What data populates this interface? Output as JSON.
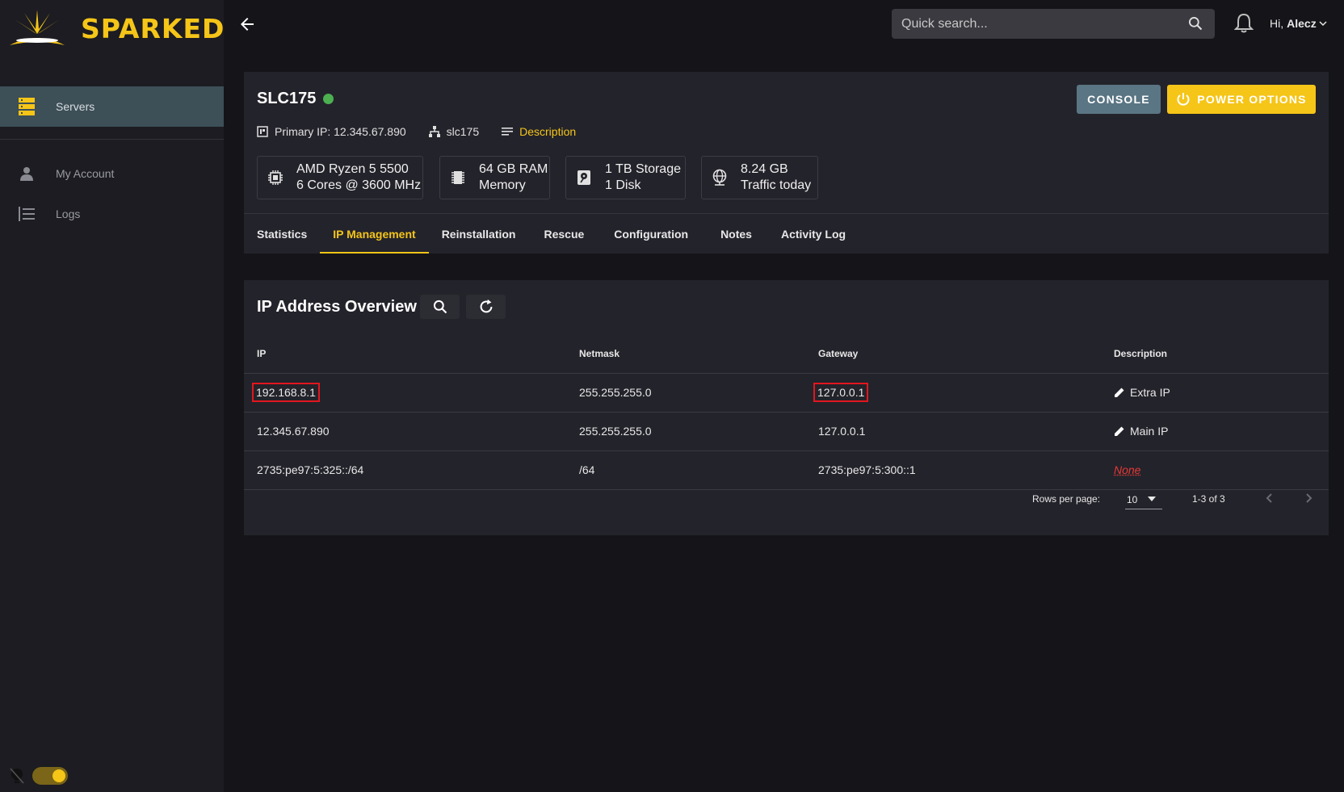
{
  "brand": {
    "name": "SPARKED",
    "accent": "#f5c518"
  },
  "sidebar": {
    "items": [
      {
        "label": "Servers",
        "icon": "server-stack-icon",
        "active": true
      },
      {
        "label": "My Account",
        "icon": "person-icon",
        "active": false
      },
      {
        "label": "Logs",
        "icon": "list-icon",
        "active": false
      }
    ]
  },
  "topbar": {
    "search_placeholder": "Quick search...",
    "greeting": "Hi,",
    "username": "Alecz"
  },
  "server": {
    "name": "SLC175",
    "status": "online",
    "status_color": "#4caf50",
    "primary_ip_label": "Primary IP: 12.345.67.890",
    "hostname": "slc175",
    "description_link": "Description",
    "console_label": "CONSOLE",
    "power_label": "POWER OPTIONS",
    "specs": [
      {
        "line1": "AMD Ryzen 5 5500",
        "line2": "6 Cores @ 3600 MHz",
        "icon": "cpu-icon"
      },
      {
        "line1": "64 GB RAM",
        "line2": "Memory",
        "icon": "memory-icon"
      },
      {
        "line1": "1 TB Storage",
        "line2": "1 Disk",
        "icon": "harddisk-icon"
      },
      {
        "line1": "8.24 GB",
        "line2": "Traffic today",
        "icon": "globe-icon"
      }
    ],
    "tabs": [
      {
        "label": "Statistics",
        "active": false
      },
      {
        "label": "IP Management",
        "active": true
      },
      {
        "label": "Reinstallation",
        "active": false
      },
      {
        "label": "Rescue",
        "active": false
      },
      {
        "label": "Configuration",
        "active": false
      },
      {
        "label": "Notes",
        "active": false
      },
      {
        "label": "Activity Log",
        "active": false
      }
    ]
  },
  "ip_overview": {
    "title": "IP Address Overview",
    "columns": [
      "IP",
      "Netmask",
      "Gateway",
      "Description"
    ],
    "rows": [
      {
        "ip": "192.168.8.1",
        "netmask": "255.255.255.0",
        "gateway": "127.0.0.1",
        "description": "Extra IP",
        "editable": true,
        "highlight": true
      },
      {
        "ip": "12.345.67.890",
        "netmask": "255.255.255.0",
        "gateway": "127.0.0.1",
        "description": "Main IP",
        "editable": true,
        "highlight": false
      },
      {
        "ip": "2735:pe97:5:325::/64",
        "netmask": "/64",
        "gateway": "2735:pe97:5:300::1",
        "description": "None",
        "editable": false,
        "highlight": false
      }
    ],
    "pagination": {
      "rows_per_page_label": "Rows per page:",
      "rows_per_page": "10",
      "range": "1-3 of 3"
    }
  }
}
